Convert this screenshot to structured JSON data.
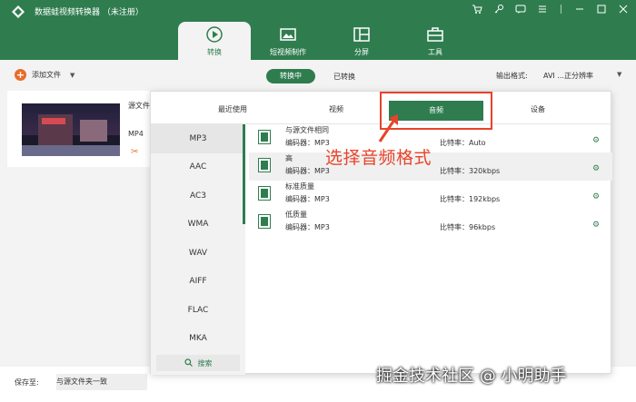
{
  "app": {
    "title": "数据蛙视频转换器 （未注册）"
  },
  "window_controls": [
    "cart-icon",
    "key-icon",
    "chat-icon",
    "menu-icon",
    "minimize-icon",
    "maximize-icon",
    "close-icon"
  ],
  "main_tabs": [
    {
      "label": "转换",
      "icon": "convert-icon",
      "active": true
    },
    {
      "label": "短视频制作",
      "icon": "image-icon",
      "active": false
    },
    {
      "label": "分屏",
      "icon": "split-icon",
      "active": false
    },
    {
      "label": "工具",
      "icon": "toolbox-icon",
      "active": false
    }
  ],
  "toolbar": {
    "add_file": "添加文件",
    "converting": "转换中",
    "converted": "已转换",
    "output_format_label": "输出格式:",
    "output_format_value": "AVI ...正分辨率"
  },
  "file": {
    "source_label": "源文件",
    "format": "MP4"
  },
  "format_panel": {
    "tabs": [
      "最近使用",
      "视频",
      "音频",
      "设备"
    ],
    "active_tab": "音频",
    "formats": [
      "MP3",
      "AAC",
      "AC3",
      "WMA",
      "WAV",
      "AIFF",
      "FLAC",
      "MKA"
    ],
    "active_format": "MP3",
    "search_label": "搜索",
    "qualities": [
      {
        "name": "与源文件相同",
        "encoder": "编码器：MP3",
        "bitrate": "比特率：Auto"
      },
      {
        "name": "高",
        "encoder": "编码器：MP3",
        "bitrate": "比特率：320kbps"
      },
      {
        "name": "标准质量",
        "encoder": "编码器：MP3",
        "bitrate": "比特率：192kbps"
      },
      {
        "name": "低质量",
        "encoder": "编码器：MP3",
        "bitrate": "比特率：96kbps"
      }
    ]
  },
  "annotation": {
    "text": "选择音频格式",
    "color": "#e8432a"
  },
  "bottom": {
    "save_label": "保存至:",
    "save_value": "与源文件夹一致"
  },
  "watermark": "掘金技术社区 @ 小明助手",
  "colors": {
    "brand": "#2f7d4f",
    "accent": "#e86d2a",
    "annotation": "#e8432a"
  }
}
